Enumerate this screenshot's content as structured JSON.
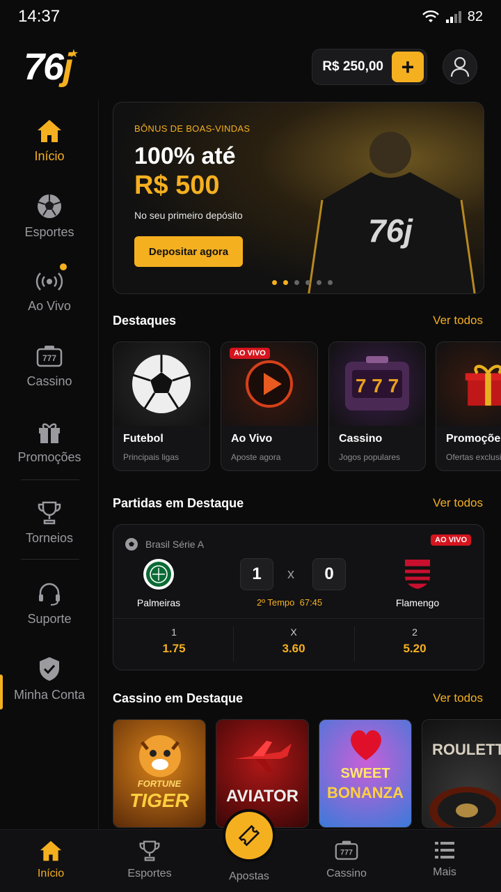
{
  "status": {
    "time": "14:37",
    "battery": "82"
  },
  "header": {
    "logo_main": "76",
    "logo_j": "j",
    "balance": "R$ 250,00",
    "add_label": "+"
  },
  "sidebar": {
    "items": [
      {
        "label": "Início"
      },
      {
        "label": "Esportes"
      },
      {
        "label": "Ao Vivo"
      },
      {
        "label": "Cassino"
      },
      {
        "label": "Promoções"
      },
      {
        "label": "Torneios"
      },
      {
        "label": "Suporte"
      },
      {
        "label": "Minha Conta"
      }
    ]
  },
  "banner": {
    "kicker": "BÔNUS DE BOAS-VINDAS",
    "headline": "100% até",
    "amount": "R$ 500",
    "subtitle": "No seu primeiro depósito",
    "cta": "Depositar agora",
    "shirt_logo": "76j"
  },
  "highlights": {
    "title": "Destaques",
    "link": "Ver todos",
    "cards": [
      {
        "title": "Futebol",
        "subtitle": "Principais ligas"
      },
      {
        "title": "Ao Vivo",
        "subtitle": "Aposte agora",
        "badge": "AO VIVO"
      },
      {
        "title": "Cassino",
        "subtitle": "Jogos populares"
      },
      {
        "title": "Promoções",
        "subtitle": "Ofertas exclusivas"
      }
    ]
  },
  "matches": {
    "title": "Partidas em Destaque",
    "link": "Ver todos",
    "featured": {
      "league": "Brasil Série A",
      "badge": "AO VIVO",
      "home": "Palmeiras",
      "away": "Flamengo",
      "home_score": "1",
      "away_score": "0",
      "separator": "x",
      "period": "2º Tempo",
      "clock": "67:45",
      "odds": [
        {
          "label": "1",
          "value": "1.75"
        },
        {
          "label": "X",
          "value": "3.60"
        },
        {
          "label": "2",
          "value": "5.20"
        }
      ]
    }
  },
  "casino": {
    "title": "Cassino em Destaque",
    "link": "Ver todos",
    "games": [
      {
        "name": "TIGER",
        "top": "FORTUNE"
      },
      {
        "name": "AVIATOR"
      },
      {
        "name": "BONANZA",
        "top": "SWEET"
      },
      {
        "name": "ROULETTE"
      }
    ]
  },
  "bottom_nav": {
    "items": [
      {
        "label": "Início"
      },
      {
        "label": "Esportes"
      },
      {
        "label": "Apostas"
      },
      {
        "label": "Cassino"
      },
      {
        "label": "Mais"
      }
    ]
  }
}
